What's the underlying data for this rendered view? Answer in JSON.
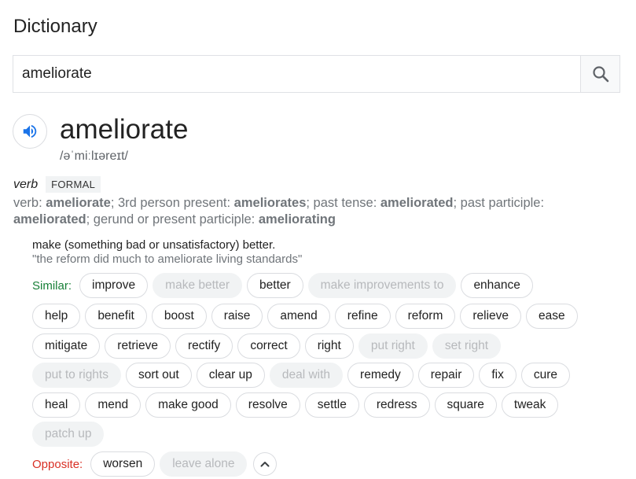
{
  "header": {
    "title": "Dictionary"
  },
  "search": {
    "value": "ameliorate",
    "button_icon": "search-icon"
  },
  "entry": {
    "word": "ameliorate",
    "phonetic": "/əˈmiːlɪəreɪt/",
    "audio_icon": "speaker-icon",
    "part_of_speech": "verb",
    "register_badge": "FORMAL",
    "forms": {
      "verb_label": "verb: ",
      "verb": "ameliorate",
      "third_label": "; 3rd person present: ",
      "third": "ameliorates",
      "past_label": "; past tense: ",
      "past": "ameliorated",
      "pp_label": "; past participle: ",
      "pp": "ameliorated",
      "gerund_label": "; gerund or present participle: ",
      "gerund": "ameliorating"
    },
    "definition": "make (something bad or unsatisfactory) better.",
    "example": "\"the reform did much to ameliorate living standards\"",
    "similar_label": "Similar:",
    "opposite_label": "Opposite:",
    "similar_rows": [
      [
        {
          "t": "improve",
          "d": false
        },
        {
          "t": "make better",
          "d": true
        },
        {
          "t": "better",
          "d": false
        },
        {
          "t": "make improvements to",
          "d": true
        },
        {
          "t": "enhance",
          "d": false
        }
      ],
      [
        {
          "t": "help",
          "d": false
        },
        {
          "t": "benefit",
          "d": false
        },
        {
          "t": "boost",
          "d": false
        },
        {
          "t": "raise",
          "d": false
        },
        {
          "t": "amend",
          "d": false
        },
        {
          "t": "refine",
          "d": false
        },
        {
          "t": "reform",
          "d": false
        },
        {
          "t": "relieve",
          "d": false
        },
        {
          "t": "ease",
          "d": false
        }
      ],
      [
        {
          "t": "mitigate",
          "d": false
        },
        {
          "t": "retrieve",
          "d": false
        },
        {
          "t": "rectify",
          "d": false
        },
        {
          "t": "correct",
          "d": false
        },
        {
          "t": "right",
          "d": false
        },
        {
          "t": "put right",
          "d": true
        },
        {
          "t": "set right",
          "d": true
        }
      ],
      [
        {
          "t": "put to rights",
          "d": true
        },
        {
          "t": "sort out",
          "d": false
        },
        {
          "t": "clear up",
          "d": false
        },
        {
          "t": "deal with",
          "d": true
        },
        {
          "t": "remedy",
          "d": false
        },
        {
          "t": "repair",
          "d": false
        },
        {
          "t": "fix",
          "d": false
        },
        {
          "t": "cure",
          "d": false
        }
      ],
      [
        {
          "t": "heal",
          "d": false
        },
        {
          "t": "mend",
          "d": false
        },
        {
          "t": "make good",
          "d": false
        },
        {
          "t": "resolve",
          "d": false
        },
        {
          "t": "settle",
          "d": false
        },
        {
          "t": "redress",
          "d": false
        },
        {
          "t": "square",
          "d": false
        },
        {
          "t": "tweak",
          "d": false
        }
      ],
      [
        {
          "t": "patch up",
          "d": true
        }
      ]
    ],
    "opposite": [
      {
        "t": "worsen",
        "d": false
      },
      {
        "t": "leave alone",
        "d": true
      }
    ],
    "collapse_icon": "chevron-up-icon"
  },
  "colors": {
    "similar_label": "#188038",
    "opposite_label": "#d93025",
    "audio": "#1a73e8"
  }
}
